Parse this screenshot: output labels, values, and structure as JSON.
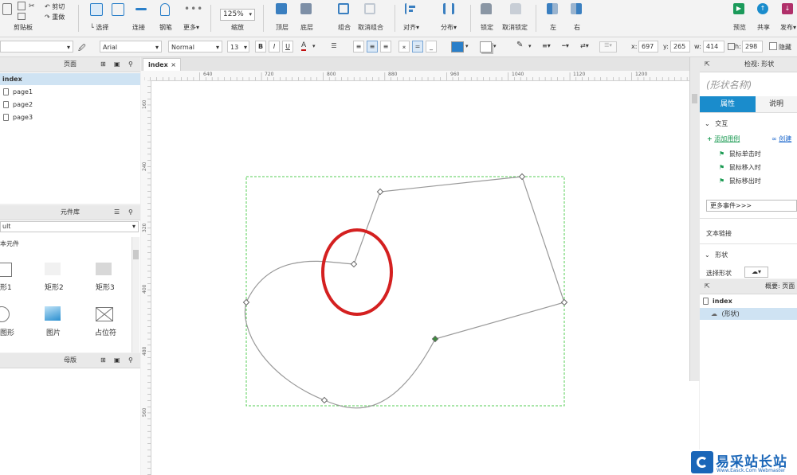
{
  "toolbar": {
    "file": {
      "clipboard": "剪贴板",
      "cut": "剪切",
      "redo": "重做"
    },
    "tools": [
      {
        "label": "选择"
      },
      {
        "label": "连接"
      },
      {
        "label": "钢笔"
      },
      {
        "label": "更多"
      }
    ],
    "zoom": {
      "value": "125%",
      "label": "缩放"
    },
    "arrange": [
      {
        "label": "顶层"
      },
      {
        "label": "底层"
      },
      {
        "label": "组合"
      },
      {
        "label": "取消组合"
      },
      {
        "label": "对齐"
      },
      {
        "label": "分布"
      },
      {
        "label": "锁定"
      },
      {
        "label": "取消锁定"
      },
      {
        "label": "左"
      },
      {
        "label": "右"
      }
    ],
    "publish": [
      {
        "label": "预览"
      },
      {
        "label": "共享"
      },
      {
        "label": "发布"
      }
    ]
  },
  "format": {
    "font": "Arial",
    "style": "Normal",
    "size": "13",
    "x_label": "x:",
    "x_value": "697",
    "y_label": "y:",
    "y_value": "265",
    "w_label": "w:",
    "w_value": "414",
    "h_label": "h:",
    "h_value": "298",
    "hide_label": "隐藏"
  },
  "pages_panel": {
    "title": "页面",
    "items": [
      {
        "label": "index",
        "selected": true
      },
      {
        "label": "page1"
      },
      {
        "label": "page2"
      },
      {
        "label": "page3"
      }
    ]
  },
  "library_panel": {
    "title": "元件库",
    "dropdown": "ult",
    "section": "本元件",
    "widgets": [
      {
        "label": "形1"
      },
      {
        "label": "矩形2"
      },
      {
        "label": "矩形3"
      },
      {
        "label": "图形"
      },
      {
        "label": "图片"
      },
      {
        "label": "占位符"
      }
    ]
  },
  "masters_panel": {
    "title": "母版"
  },
  "tab": {
    "label": "index",
    "close": "×"
  },
  "ruler": {
    "top": [
      "640",
      "720",
      "800",
      "880",
      "960",
      "1040",
      "1120",
      "1200"
    ],
    "left": [
      "160",
      "240",
      "320",
      "400",
      "480",
      "560"
    ]
  },
  "inspector": {
    "header": "检视: 形状",
    "shape_name": "(形状名称)",
    "tab_properties": "属性",
    "tab_notes": "说明",
    "interactions_title": "交互",
    "add_case": "添加用例",
    "create_link": "创建",
    "events": [
      "鼠标单击时",
      "鼠标移入时",
      "鼠标移出时"
    ],
    "more_events": "更多事件>>>",
    "text_link": "文本链接",
    "shape_section": "形状",
    "select_shape": "选择形状"
  },
  "outline_panel": {
    "title": "概要: 页面",
    "items": [
      {
        "label": "index"
      },
      {
        "label": "(形状)"
      }
    ]
  },
  "watermark": {
    "title": "易采站长站",
    "subtitle": "Www.Easck.Com  Webmaster"
  },
  "colors": {
    "accent": "#1a8ccc",
    "selection_dash": "#55cc55",
    "highlight_circle": "#d42020"
  }
}
